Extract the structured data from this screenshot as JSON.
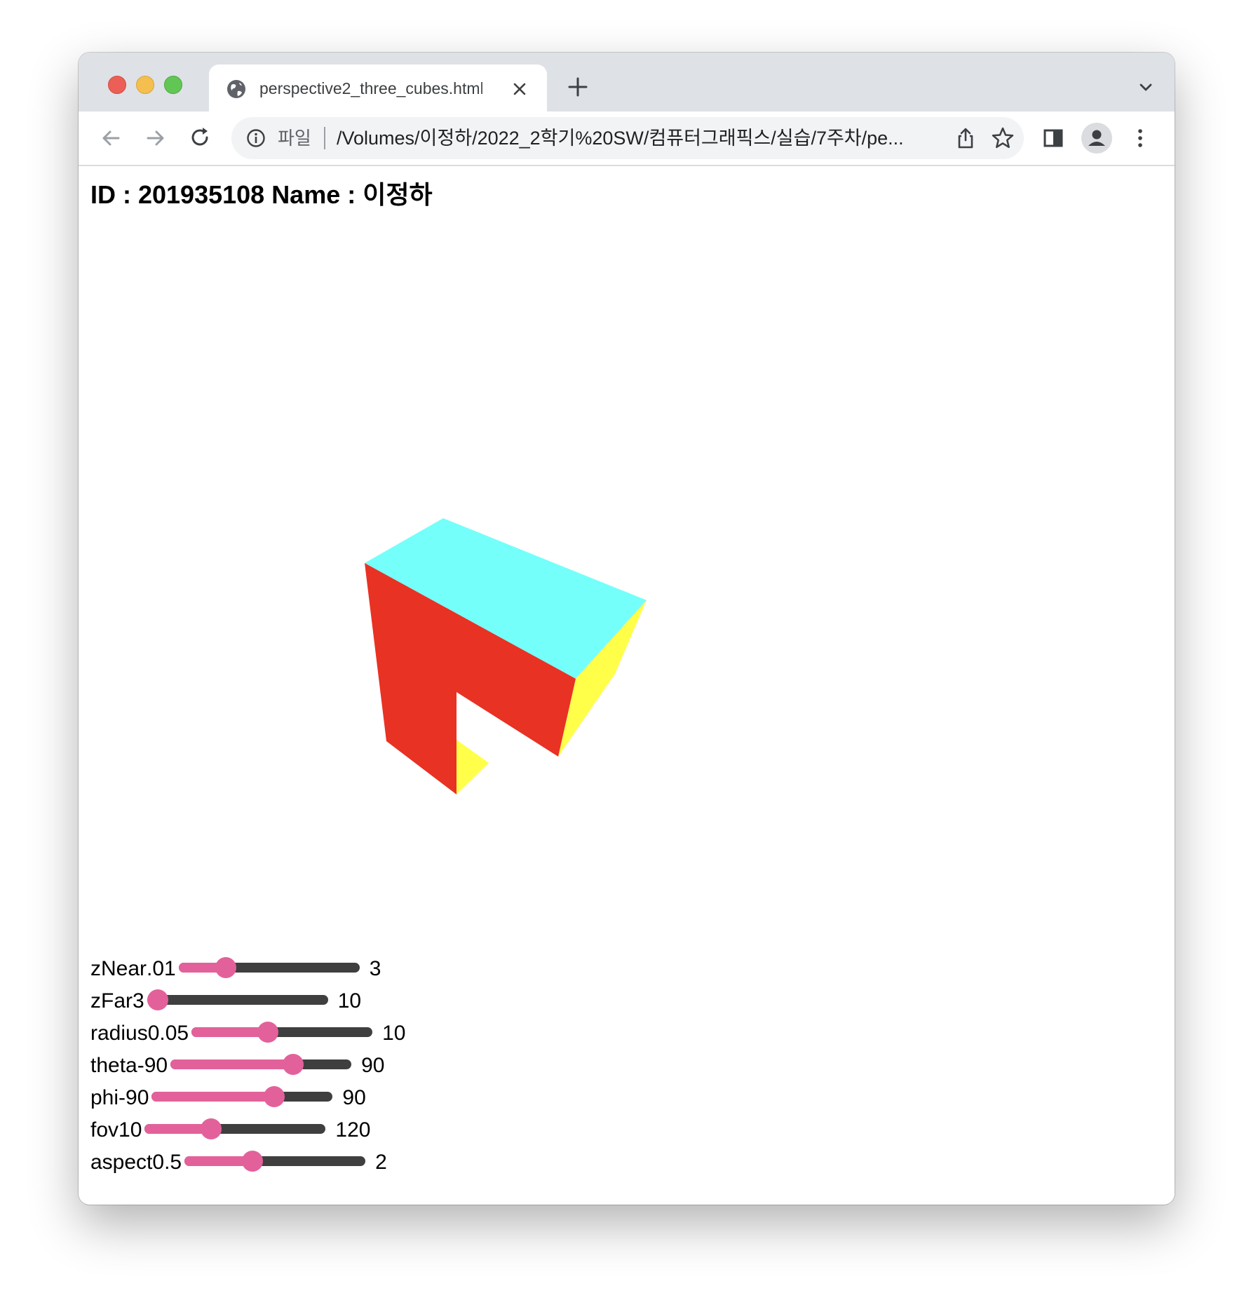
{
  "browser": {
    "tab_title": "perspective2_three_cubes.html",
    "address_chip": "파일",
    "url": "/Volumes/이정하/2022_2학기%20SW/컴퓨터그래픽스/실습/7주차/pe..."
  },
  "page": {
    "heading": "ID : 201935108 Name : 이정하"
  },
  "scene": {
    "colors": {
      "top": "#75fffb",
      "front": "#e83223",
      "side": "#ffff4a"
    }
  },
  "sliders": [
    {
      "name": "zNear",
      "min": ".01",
      "max": "3",
      "fraction": 0.23
    },
    {
      "name": "zFar",
      "min": "3",
      "max": "10",
      "fraction": 0.0
    },
    {
      "name": "radius",
      "min": "0.05",
      "max": "10",
      "fraction": 0.41
    },
    {
      "name": "theta",
      "min": "-90",
      "max": "90",
      "fraction": 0.7
    },
    {
      "name": "phi",
      "min": "-90",
      "max": "90",
      "fraction": 0.7
    },
    {
      "name": "fov",
      "min": "10",
      "max": "120",
      "fraction": 0.35
    },
    {
      "name": "aspect",
      "min": "0.5",
      "max": "2",
      "fraction": 0.36
    }
  ],
  "slider_colors": {
    "fill": "#e3619b",
    "track": "#3f3f3f"
  }
}
